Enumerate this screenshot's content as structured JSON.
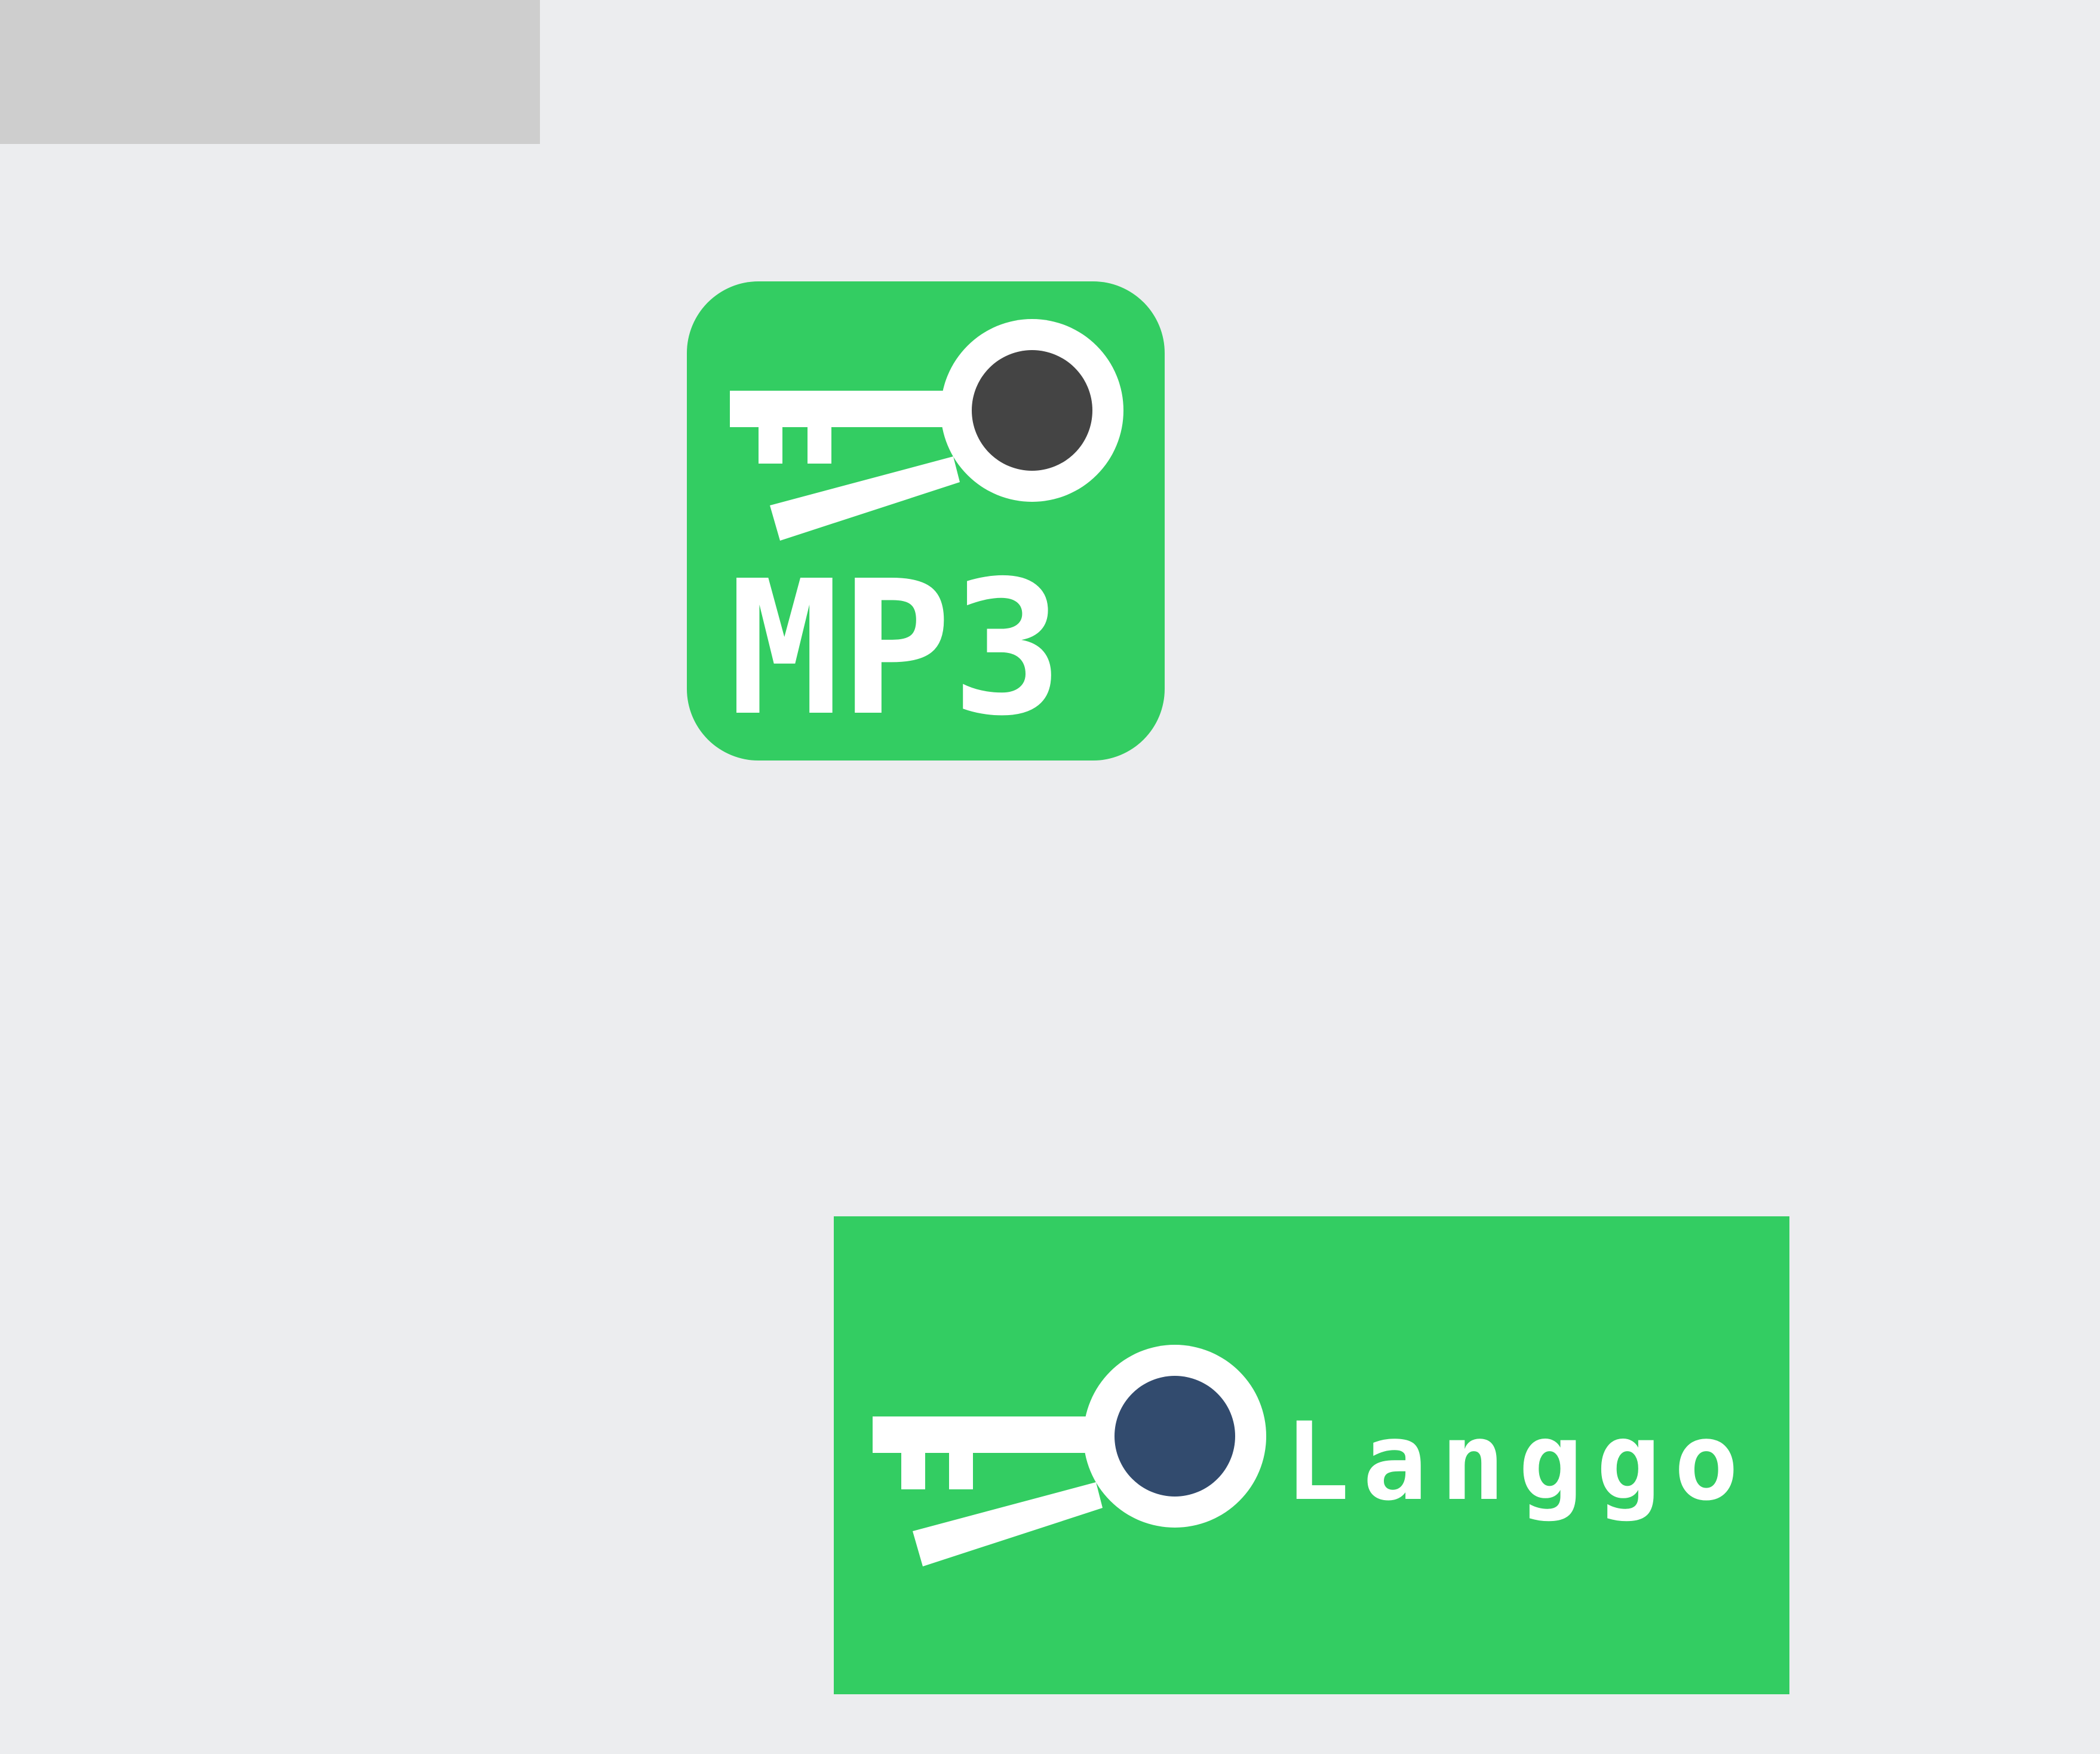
{
  "top_bar": {
    "color": "#CECECE"
  },
  "app_icon": {
    "background": "#33CD62",
    "key_dot_color": "#444444",
    "label": "MP3"
  },
  "brand_banner": {
    "background": "#33CD62",
    "key_dot_color": "#324B6E",
    "wordmark": "Langgo"
  },
  "page": {
    "background": "#ECEDEF"
  }
}
